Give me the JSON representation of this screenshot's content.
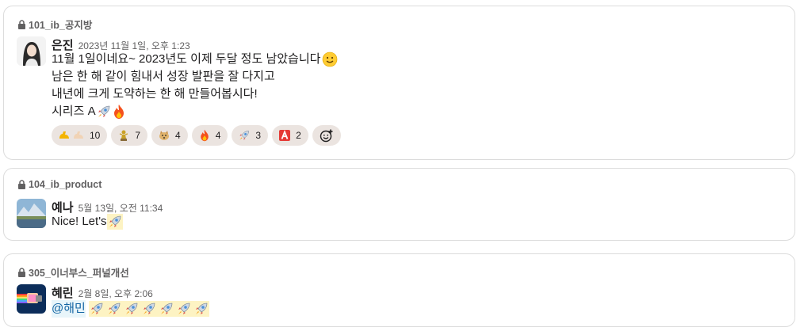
{
  "messages": [
    {
      "channel": "101_ib_공지방",
      "author": "은진",
      "timestamp": "2023년 11월 1일, 오후 1:23",
      "lines": [
        "11월 1일이네요~ 2023년도 이제 두달 정도 남았습니다",
        "남은 한 해 같이 힘내서 성장 발판을 잘 다지고",
        "내년에 크게 도약하는 한 해 만들어봅시다!",
        "시리즈 A"
      ],
      "reactions": [
        {
          "emoji": "flexed-biceps",
          "count": "10"
        },
        {
          "emoji": "statue",
          "count": "7"
        },
        {
          "emoji": "doge",
          "count": "4"
        },
        {
          "emoji": "fire",
          "count": "4"
        },
        {
          "emoji": "rocket",
          "count": "3"
        },
        {
          "emoji": "letter-a",
          "count": "2"
        }
      ]
    },
    {
      "channel": "104_ib_product",
      "author": "예나",
      "timestamp": "5월 13일, 오전 11:34",
      "lines": [
        "Nice! Let's"
      ]
    },
    {
      "channel": "305_이너부스_퍼널개선",
      "author": "혜린",
      "timestamp": "2월 8일, 오후 2:06",
      "mention": "@해민"
    }
  ],
  "colors": {
    "accent": "#1264a3",
    "reaction_bg": "#ebe4e0",
    "highlight": "#fdf3c3"
  }
}
